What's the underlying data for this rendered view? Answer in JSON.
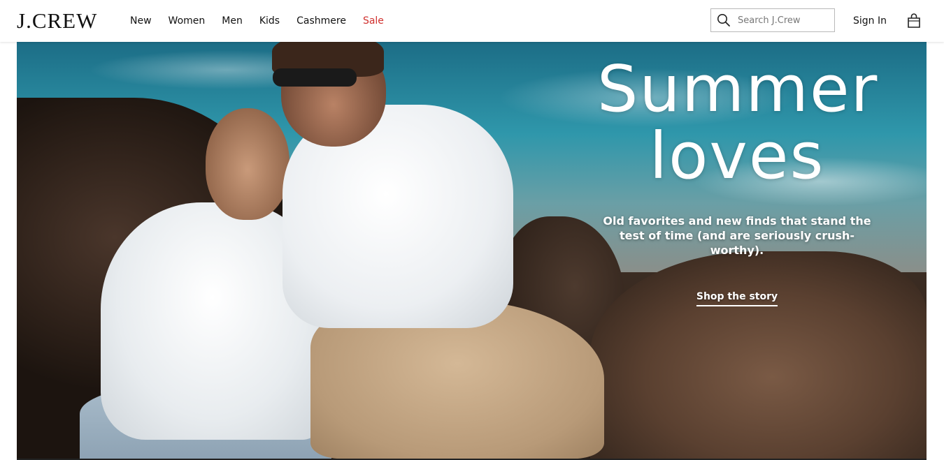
{
  "header": {
    "logo": "J.CREW",
    "nav": [
      {
        "label": "New"
      },
      {
        "label": "Women"
      },
      {
        "label": "Men"
      },
      {
        "label": "Kids"
      },
      {
        "label": "Cashmere"
      },
      {
        "label": "Sale",
        "color": "#d0302e"
      }
    ],
    "search_placeholder": "Search J.Crew",
    "sign_in": "Sign In",
    "icons": {
      "search": "search-icon",
      "bag": "shopping-bag-icon"
    }
  },
  "hero": {
    "headline_line1": "Summer",
    "headline_line2": "loves",
    "subhead_line1": "Old favorites and new finds that stand the",
    "subhead_line2": "test of time (and are seriously crush-worthy).",
    "cta": "Shop the story"
  },
  "colors": {
    "sale": "#d0302e",
    "text": "#111111"
  }
}
